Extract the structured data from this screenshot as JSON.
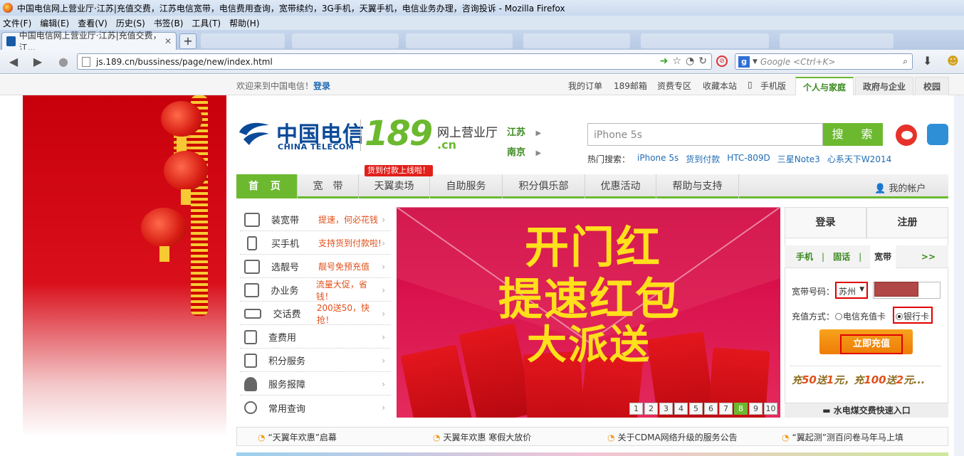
{
  "window": {
    "title": "中国电信网上营业厅·江苏|充值交费，江苏电信宽带，电信费用查询，宽带续约，3G手机，天翼手机，电信业务办理，咨询投诉 - Mozilla Firefox"
  },
  "menu": [
    "文件(F)",
    "编辑(E)",
    "查看(V)",
    "历史(S)",
    "书签(B)",
    "工具(T)",
    "帮助(H)"
  ],
  "browser": {
    "tab_label": "中国电信网上营业厅·江苏|充值交费，江...",
    "new_tab": "+",
    "url": "js.189.cn/bussiness/page/new/index.html",
    "search_placeholder": "Google <Ctrl+K>",
    "search_engine": "g-icon"
  },
  "topbar": {
    "welcome": "欢迎来到中国电信！",
    "login": "登录",
    "links": [
      "我的订单",
      "189邮箱",
      "资费专区",
      "收藏本站",
      "手机版"
    ],
    "tabs": [
      "个人与家庭",
      "政府与企业",
      "校园"
    ]
  },
  "header": {
    "logo_cn": "中国电信",
    "logo_en": "CHINA TELECOM",
    "logo_num": "189",
    "logo_sfx": ".cn",
    "logo_title": "网上营业厅",
    "province": "江苏",
    "city": "南京",
    "search_value": "iPhone 5s",
    "search_button": "搜 索",
    "hot_label": "热门搜索：",
    "hot_keywords": [
      "iPhone 5s",
      "货到付款",
      "HTC-809D",
      "三星Note3",
      "心系天下W2014"
    ]
  },
  "nav": {
    "items": [
      "首 页",
      "宽　带",
      "天翼卖场",
      "自助服务",
      "积分俱乐部",
      "优惠活动",
      "帮助与支持"
    ],
    "badge": "货到付款上线啦！",
    "account": "我的帐户"
  },
  "services": [
    {
      "name": "装宽带",
      "desc": "提速，何必花钱"
    },
    {
      "name": "买手机",
      "desc": "支持货到付款啦!"
    },
    {
      "name": "选靓号",
      "desc": "靓号免预充值"
    },
    {
      "name": "办业务",
      "desc": "流量大促，省钱！"
    },
    {
      "name": "交话费",
      "desc": "200送50，快抢！"
    },
    {
      "name": "查费用",
      "desc": ""
    },
    {
      "name": "积分服务",
      "desc": ""
    },
    {
      "name": "服务报障",
      "desc": ""
    },
    {
      "name": "常用查询",
      "desc": ""
    }
  ],
  "banner": {
    "line1": "开门红",
    "line2": "提速红包",
    "line3": "大派送",
    "pages": [
      "1",
      "2",
      "3",
      "4",
      "5",
      "6",
      "7",
      "8",
      "9",
      "10"
    ],
    "active_page": "8"
  },
  "recharge": {
    "login": "登录",
    "register": "注册",
    "tabs": [
      "手机",
      "固话",
      "宽带"
    ],
    "more": ">>",
    "account_label": "宽带号码：",
    "city_value": "苏州",
    "method_label": "充值方式：",
    "method_card": "电信充值卡",
    "method_bank": "银行卡",
    "button": "立即充值",
    "promo_parts": [
      "充",
      "50",
      "送",
      "1",
      "元，充",
      "100",
      "送",
      "2",
      "元..."
    ],
    "utility": "水电煤交费快速入口"
  },
  "news": [
    "“天翼年欢惠”启幕",
    "天翼年欢惠 寒假大放价",
    "关于CDMA网络升级的服务公告",
    "“翼起测”测百问卷马年马上填"
  ],
  "colors": {
    "accent_green": "#6cb92f",
    "brand_blue": "#0b4a98",
    "alert_red": "#e1201b",
    "orange": "#ee7c06"
  }
}
